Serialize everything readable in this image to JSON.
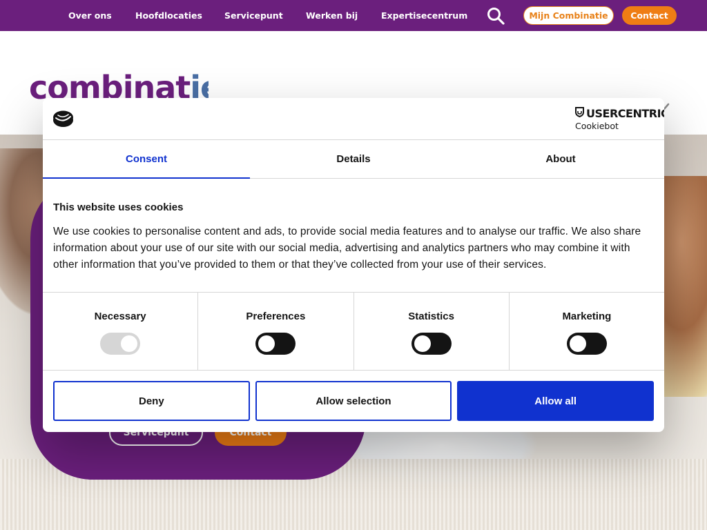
{
  "nav": {
    "items": [
      {
        "label": "Over ons"
      },
      {
        "label": "Hoofdlocaties"
      },
      {
        "label": "Servicepunt"
      },
      {
        "label": "Werken bij"
      },
      {
        "label": "Expertisecentrum"
      }
    ],
    "search_icon": "search-icon",
    "mijn_label": "Mijn Combinatie",
    "contact_label": "Contact"
  },
  "logo": {
    "text_main": "combinat",
    "text_tail": "ie"
  },
  "hero": {
    "service_label": "Servicepunt",
    "contact_label": "Contact"
  },
  "cookie": {
    "brand_name": "USERCENTRICS",
    "brand_sub": "Cookiebot",
    "tabs": [
      {
        "label": "Consent",
        "active": true
      },
      {
        "label": "Details",
        "active": false
      },
      {
        "label": "About",
        "active": false
      }
    ],
    "title": "This website uses cookies",
    "text": "We use cookies to personalise content and ads, to provide social media features and to analyse our traffic. We also share information about your use of our site with our social media, advertising and analytics partners who may combine it with other information that you’ve provided to them or that they’ve collected from your use of their services.",
    "categories": [
      {
        "label": "Necessary",
        "state": "on-disabled"
      },
      {
        "label": "Preferences",
        "state": "off"
      },
      {
        "label": "Statistics",
        "state": "off"
      },
      {
        "label": "Marketing",
        "state": "off"
      }
    ],
    "buttons": {
      "deny": "Deny",
      "selection": "Allow selection",
      "all": "Allow all"
    }
  },
  "colors": {
    "brand_purple": "#6b1f7d",
    "brand_orange": "#ef7d14",
    "cookie_blue": "#1032cf"
  }
}
